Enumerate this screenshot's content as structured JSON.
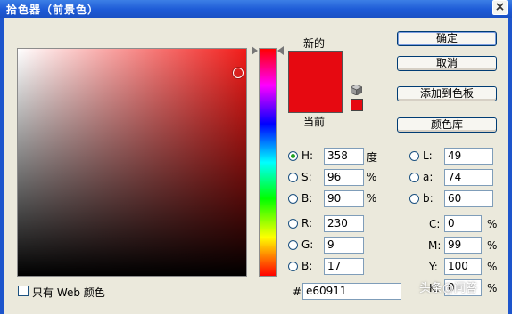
{
  "window": {
    "title": "拾色器（前景色）",
    "close": "×"
  },
  "buttons": {
    "ok": "确定",
    "cancel": "取消",
    "add_swatch": "添加到色板",
    "color_library": "颜色库"
  },
  "swatch": {
    "new_label": "新的",
    "current_label": "当前",
    "new_color": "#e60911",
    "current_color": "#e60911"
  },
  "fields": {
    "h": {
      "label": "H:",
      "value": "358",
      "unit": "度",
      "selected": true
    },
    "s": {
      "label": "S:",
      "value": "96",
      "unit": "%"
    },
    "b": {
      "label": "B:",
      "value": "90",
      "unit": "%"
    },
    "r": {
      "label": "R:",
      "value": "230"
    },
    "g": {
      "label": "G:",
      "value": "9"
    },
    "bl": {
      "label": "B:",
      "value": "17"
    },
    "l": {
      "label": "L:",
      "value": "49"
    },
    "a": {
      "label": "a:",
      "value": "74"
    },
    "lab_b": {
      "label": "b:",
      "value": "60"
    },
    "c": {
      "label": "C:",
      "value": "0",
      "unit": "%"
    },
    "m": {
      "label": "M:",
      "value": "99",
      "unit": "%"
    },
    "y": {
      "label": "Y:",
      "value": "100",
      "unit": "%"
    },
    "k": {
      "label": "K:",
      "value": "0",
      "unit": "%"
    },
    "hex": {
      "label": "#",
      "value": "e60911"
    }
  },
  "web_only": {
    "label": "只有 Web 颜色",
    "checked": false
  },
  "watermark": "头条@问答",
  "colors": {
    "picker_hue": "#f21c19",
    "titlebar": "#1d5ad6",
    "dialog_bg": "#ebe9dc"
  }
}
